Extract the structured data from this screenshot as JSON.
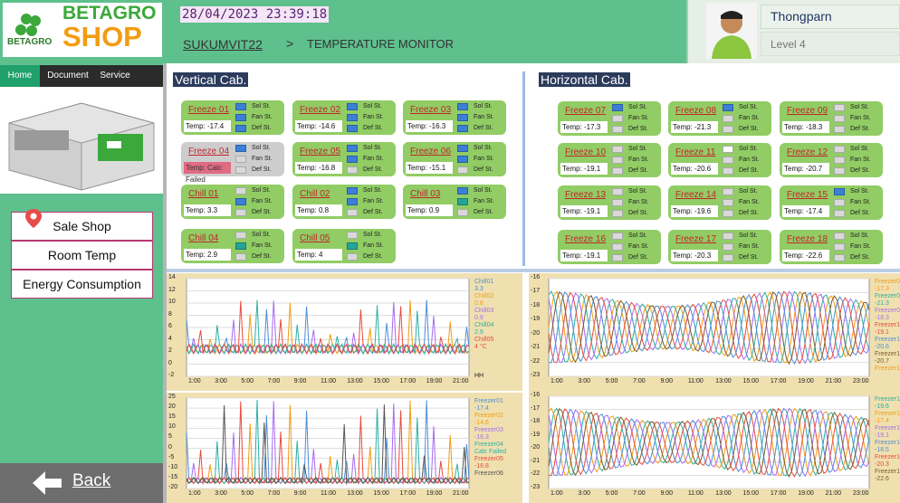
{
  "brand": {
    "logo_text": "BETAGRO",
    "shop_text_1": "BETAGRO",
    "shop_text_2": "SHOP",
    "color": "#3aa83a"
  },
  "header": {
    "datetime": "28/04/2023 23:39:18",
    "site": "SUKUMVIT22",
    "separator": ">",
    "page": "TEMPERATURE MONITOR"
  },
  "user": {
    "name": "Thongparn",
    "level": "Level 4"
  },
  "nav": {
    "tabs": [
      "Home",
      "Document",
      "Service"
    ]
  },
  "menu": {
    "sale_shop": "Sale Shop",
    "room_temp": "Room Temp",
    "energy": "Energy Consumption",
    "back": "Back"
  },
  "sections": {
    "vertical": "Vertical Cab.",
    "horizontal": "Horizontal Cab."
  },
  "status_labels": [
    "Sol St.",
    "Fan St.",
    "Def St."
  ],
  "colors": {
    "green": "#91cc64",
    "header": "#5ec08d",
    "blue": "#3d7fd6",
    "teal": "#25a59a",
    "red": "#c0272d"
  },
  "cabinets": [
    {
      "name": "Freeze 01",
      "temp": "Temp:  -17.4",
      "st": [
        "blue",
        "blue",
        "blue"
      ]
    },
    {
      "name": "Freeze 02",
      "temp": "Temp:  -14.6",
      "st": [
        "blue",
        "blue",
        "blue"
      ]
    },
    {
      "name": "Freeze 03",
      "temp": "Temp:  -16.3",
      "st": [
        "blue",
        "blue",
        "blue"
      ]
    },
    {
      "name": "Freeze 04",
      "temp": "Temp:  Calc Failed",
      "st": [
        "blue",
        "gray",
        "gray"
      ],
      "gray": true,
      "err": true
    },
    {
      "name": "Freeze 05",
      "temp": "Temp:  -16.8",
      "st": [
        "blue",
        "blue",
        "gray"
      ]
    },
    {
      "name": "Freeze 06",
      "temp": "Temp:  -15.1",
      "st": [
        "blue",
        "blue",
        "gray"
      ]
    },
    {
      "name": "Chill 01",
      "temp": "Temp:  3.3",
      "st": [
        "gray",
        "blue",
        "gray"
      ]
    },
    {
      "name": "Chill 02",
      "temp": "Temp:  0.8",
      "st": [
        "blue",
        "blue",
        "gray"
      ]
    },
    {
      "name": "Chill 03",
      "temp": "Temp:  0.9",
      "st": [
        "blue",
        "teal",
        "gray"
      ]
    },
    {
      "name": "Chill 04",
      "temp": "Temp:  2.9",
      "st": [
        "gray",
        "teal",
        "gray"
      ]
    },
    {
      "name": "Chill 05",
      "temp": "Temp:  4",
      "st": [
        "gray",
        "teal",
        "gray"
      ]
    },
    {
      "name": "Freeze 07",
      "temp": "Temp:  -17.3",
      "st": [
        "blue",
        "gray",
        "gray"
      ]
    },
    {
      "name": "Freeze 08",
      "temp": "Temp:  -21.3",
      "st": [
        "blue",
        "gray",
        "gray"
      ]
    },
    {
      "name": "Freeze 09",
      "temp": "Temp:  -18.3",
      "st": [
        "gray",
        "gray",
        "gray"
      ]
    },
    {
      "name": "Freeze 10",
      "temp": "Temp:  -19.1",
      "st": [
        "gray",
        "gray",
        "gray"
      ]
    },
    {
      "name": "Freeze 11",
      "temp": "Temp:  -20.6",
      "st": [
        "white",
        "gray",
        "gray"
      ]
    },
    {
      "name": "Freeze 12",
      "temp": "Temp:  -20.7",
      "st": [
        "gray",
        "gray",
        "gray"
      ]
    },
    {
      "name": "Freeze 13",
      "temp": "Temp:  -19.1",
      "st": [
        "gray",
        "gray",
        "gray"
      ]
    },
    {
      "name": "Freeze 14",
      "temp": "Temp:  -19.6",
      "st": [
        "gray",
        "gray",
        "gray"
      ]
    },
    {
      "name": "Freeze 15",
      "temp": "Temp:  -17.4",
      "st": [
        "blue",
        "gray",
        "gray"
      ]
    },
    {
      "name": "Freeze 16",
      "temp": "Temp:  -19.1",
      "st": [
        "gray",
        "gray",
        "gray"
      ]
    },
    {
      "name": "Freeze 17",
      "temp": "Temp:  -20.3",
      "st": [
        "gray",
        "gray",
        "gray"
      ]
    },
    {
      "name": "Freeze 18",
      "temp": "Temp:  -22.6",
      "st": [
        "gray",
        "gray",
        "gray"
      ]
    }
  ],
  "chart_data": [
    {
      "type": "line",
      "yticks": [
        "14",
        "12",
        "10",
        "8",
        "6",
        "4",
        "2",
        "0",
        "-2"
      ],
      "ylim": [
        -2,
        14
      ],
      "xticks": [
        "1:00",
        "3:00",
        "5:00",
        "7:00",
        "9:00",
        "11:00",
        "13:00",
        "15:00",
        "17:00",
        "19:00",
        "21:00"
      ],
      "axis_unit": "HH",
      "legend": [
        [
          "Chill01",
          "3.3"
        ],
        [
          "Chill02",
          "0.8"
        ],
        [
          "Chill03",
          "0.9"
        ],
        [
          "Chill04",
          "2.9"
        ],
        [
          "Chill05",
          "4 °C"
        ]
      ],
      "series_colors": [
        "#4b8fd8",
        "#f39c12",
        "#a66cf0",
        "#29b1a4",
        "#e74c3c"
      ],
      "baseline": 2.5,
      "amp": 8
    },
    {
      "type": "line",
      "yticks": [
        "25",
        "20",
        "15",
        "10",
        "5",
        "0",
        "-5",
        "-10",
        "-15",
        "-20"
      ],
      "ylim": [
        -20,
        25
      ],
      "xticks": [
        "1:00",
        "3:00",
        "5:00",
        "7:00",
        "9:00",
        "11:00",
        "13:00",
        "15:00",
        "17:00",
        "19:00",
        "21:00"
      ],
      "legend": [
        [
          "Freezer01",
          "-17.4"
        ],
        [
          "Freezer02",
          "-14.6"
        ],
        [
          "Freezer03",
          "-16.3"
        ],
        [
          "Freezer04",
          "Calc Failed"
        ],
        [
          "Freezer05",
          "-16.8"
        ],
        [
          "Freezer06",
          ""
        ]
      ],
      "series_colors": [
        "#4b8fd8",
        "#f39c12",
        "#a66cf0",
        "#29b1a4",
        "#e74c3c",
        "#555"
      ],
      "baseline": -16,
      "amp": 40
    },
    {
      "type": "line",
      "yticks": [
        "-16",
        "-17",
        "-18",
        "-19",
        "-20",
        "-21",
        "-22",
        "-23"
      ],
      "ylim": [
        -23,
        -16
      ],
      "xticks": [
        "1:00",
        "3:00",
        "5:00",
        "7:00",
        "9:00",
        "11:00",
        "13:00",
        "15:00",
        "17:00",
        "19:00",
        "21:00",
        "23:00"
      ],
      "legend": [
        [
          "Freezer0",
          "-17.3"
        ],
        [
          "Freezer0",
          "-21.3"
        ],
        [
          "Freezer0",
          "-18.3"
        ],
        [
          "Freezer1",
          "-19.1"
        ],
        [
          "Freezer1",
          "-20.6"
        ],
        [
          "Freezer1",
          "-20.7"
        ],
        [
          "Freezer1",
          ""
        ]
      ],
      "series_colors": [
        "#f39c12",
        "#29b1a4",
        "#a66cf0",
        "#e74c3c",
        "#4b8fd8",
        "#7a5a2e"
      ],
      "baseline": -19.5,
      "amp": 2.6
    },
    {
      "type": "line",
      "yticks": [
        "-16",
        "-17",
        "-18",
        "-19",
        "-20",
        "-21",
        "-22",
        "-23"
      ],
      "ylim": [
        -23,
        -16
      ],
      "xticks": [
        "1:00",
        "3:00",
        "5:00",
        "7:00",
        "9:00",
        "11:00",
        "13:00",
        "15:00",
        "17:00",
        "19:00",
        "21:00",
        "23:00"
      ],
      "legend": [
        [
          "Freezer1",
          "-19.6"
        ],
        [
          "Freezer1",
          "-17.4"
        ],
        [
          "Freezer1",
          "-19.1"
        ],
        [
          "Freezer1",
          "-18.5"
        ],
        [
          "Freezer1",
          "-20.3"
        ],
        [
          "Freezer1",
          "-22.6"
        ]
      ],
      "series_colors": [
        "#29b1a4",
        "#f39c12",
        "#a66cf0",
        "#4b8fd8",
        "#e74c3c",
        "#7a5a2e"
      ],
      "baseline": -19.5,
      "amp": 2.6
    }
  ]
}
